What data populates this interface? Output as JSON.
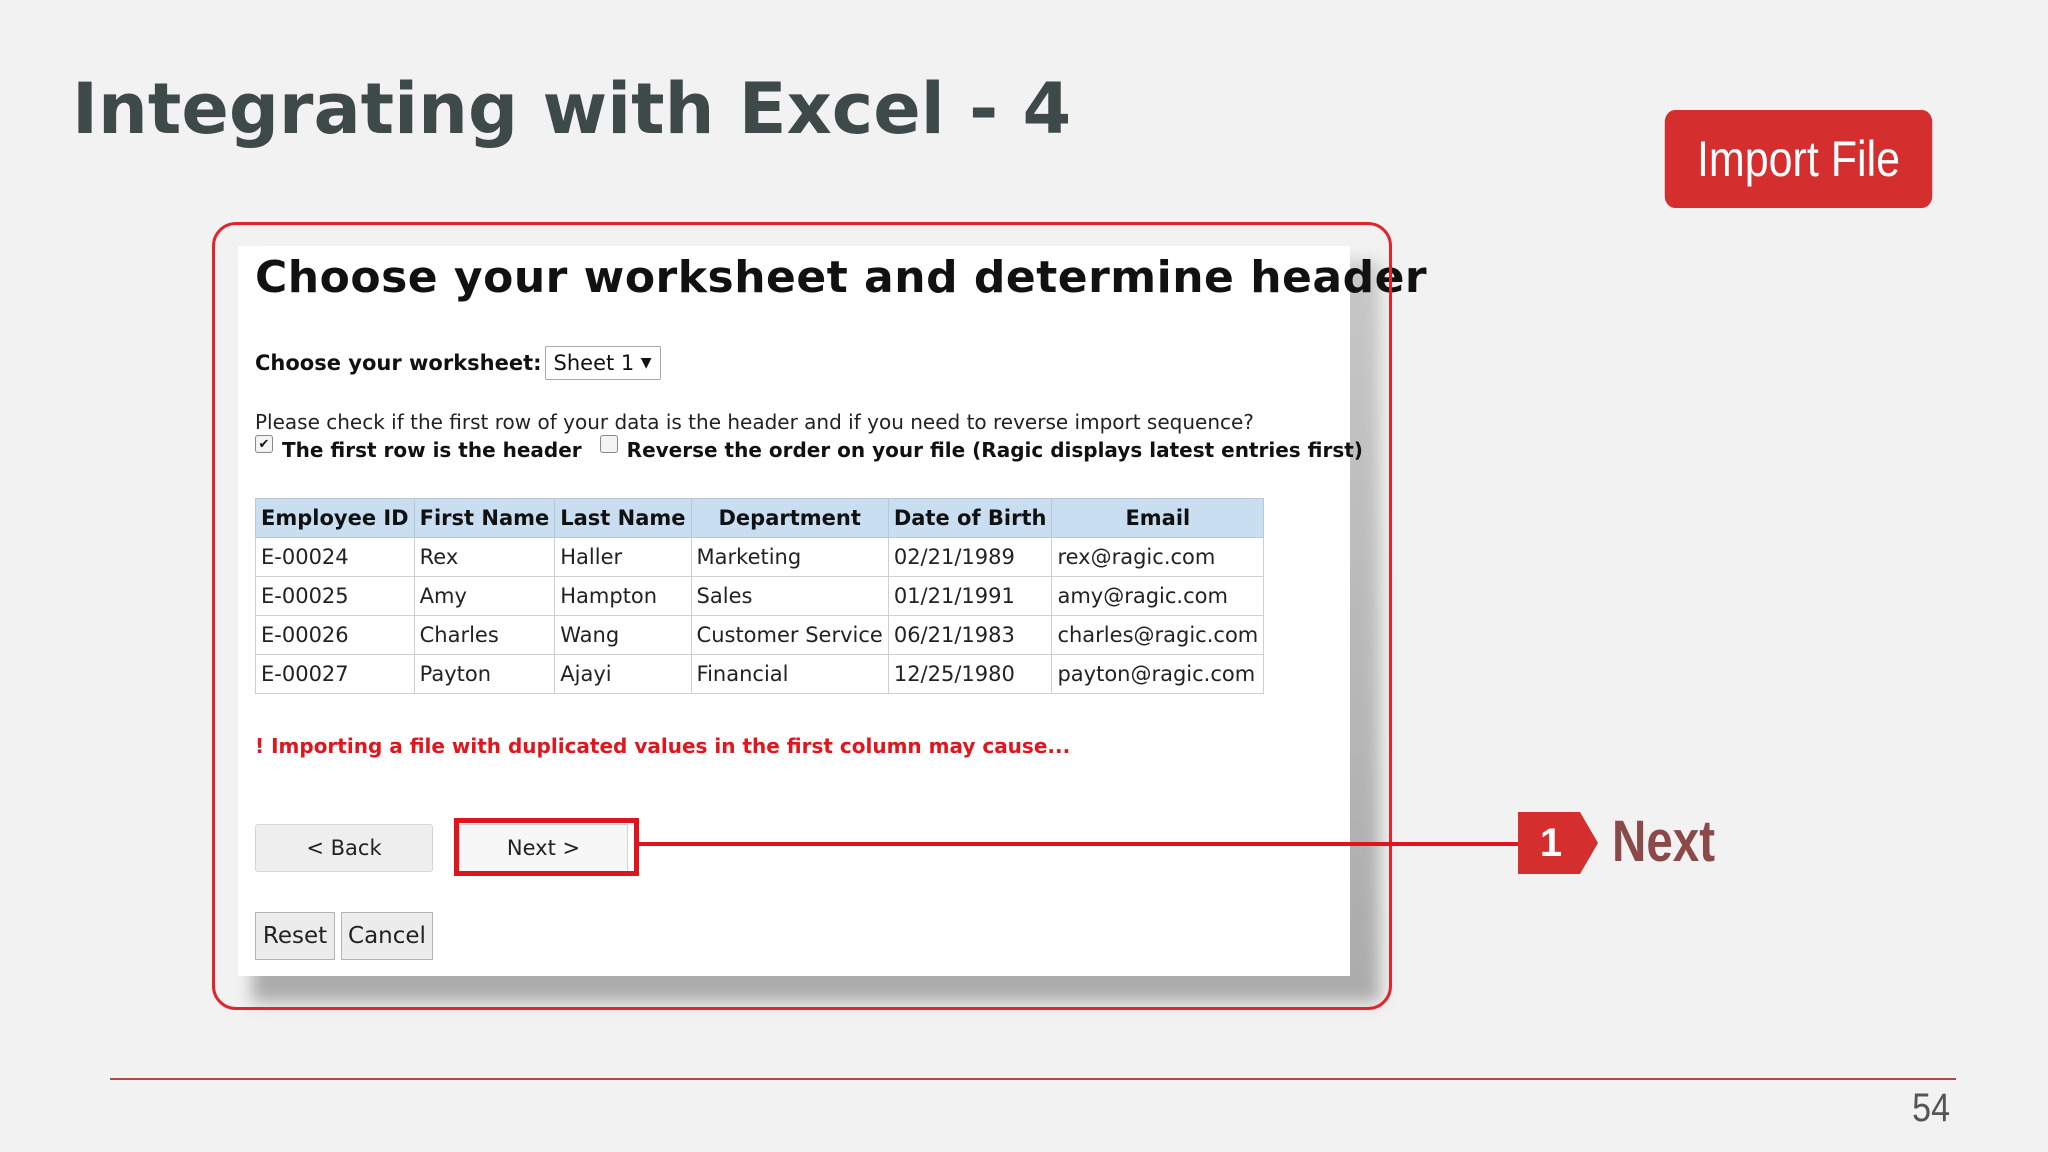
{
  "slide": {
    "title": "Integrating with Excel - 4",
    "badge": "Import File",
    "page_number": "54"
  },
  "dialog": {
    "title": "Choose your worksheet and determine header",
    "worksheet_label": "Choose your worksheet:",
    "worksheet_selected": "Sheet 1",
    "instruction": "Please check if the first row of your data is the header and if you need to reverse import sequence?",
    "option_header_label": "The first row is the header",
    "option_header_checked": true,
    "option_reverse_label": "Reverse the order on your file (Ragic displays latest entries first)",
    "option_reverse_checked": false,
    "warning_mark": "!",
    "warning": "Importing a file with duplicated values in the first column may cause...",
    "back_label": "< Back",
    "next_label": "Next >",
    "reset_label": "Reset",
    "cancel_label": "Cancel"
  },
  "table": {
    "headers": [
      "Employee ID",
      "First Name",
      "Last Name",
      "Department",
      "Date of Birth",
      "Email"
    ],
    "rows": [
      [
        "E-00024",
        "Rex",
        "Haller",
        "Marketing",
        "02/21/1989",
        "rex@ragic.com"
      ],
      [
        "E-00025",
        "Amy",
        "Hampton",
        "Sales",
        "01/21/1991",
        "amy@ragic.com"
      ],
      [
        "E-00026",
        "Charles",
        "Wang",
        "Customer Service",
        "06/21/1983",
        "charles@ragic.com"
      ],
      [
        "E-00027",
        "Payton",
        "Ajayi",
        "Financial",
        "12/25/1980",
        "payton@ragic.com"
      ]
    ]
  },
  "annotation": {
    "step_number": "1",
    "step_label": "Next"
  },
  "colors": {
    "accent_red": "#d42e2e",
    "highlight_red": "#e0141c",
    "table_header": "#c9dff1",
    "title_gray": "#3e4a49"
  },
  "icons": {
    "dropdown": "chevron-down-icon",
    "checkbox_checked": "checkmark-icon"
  }
}
